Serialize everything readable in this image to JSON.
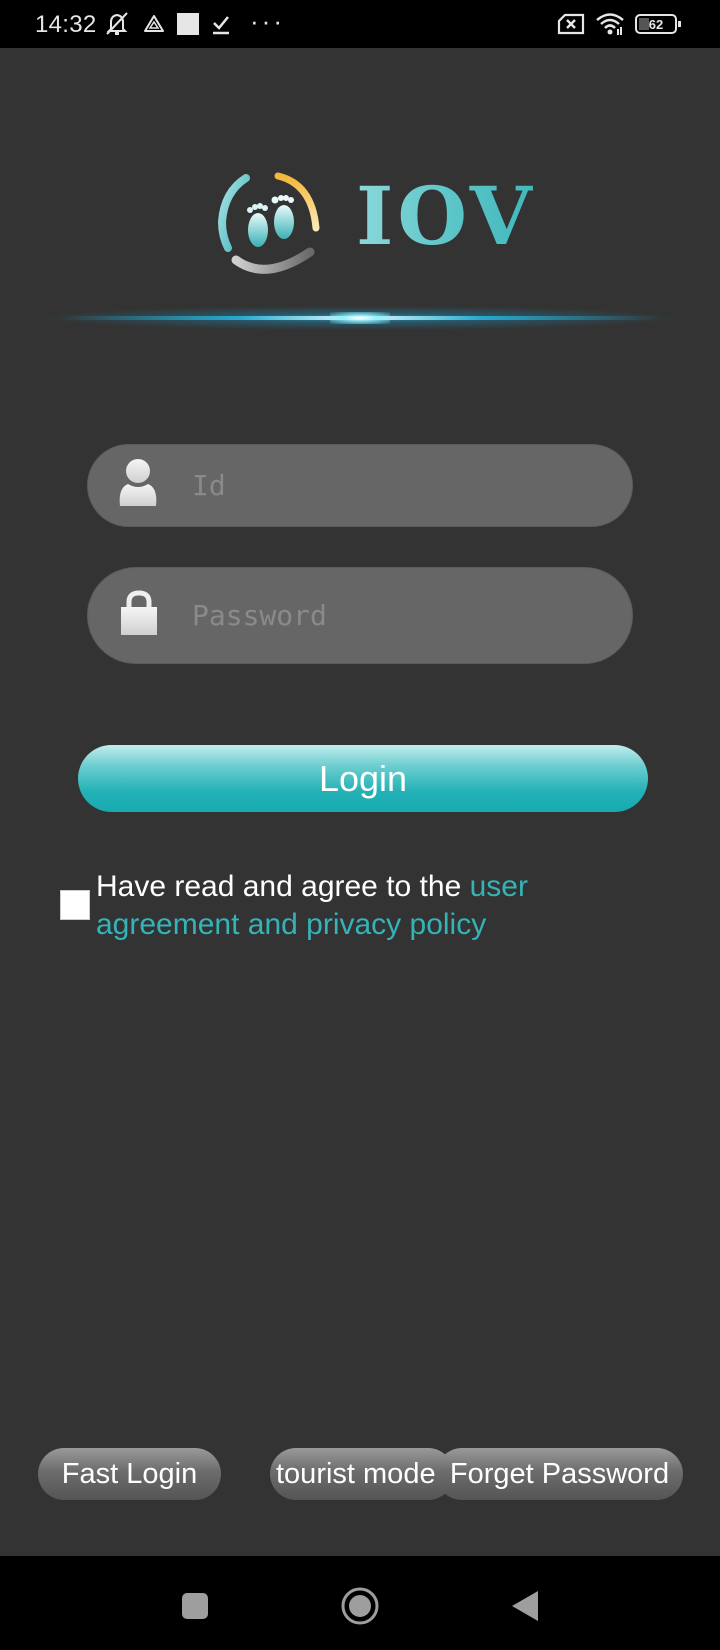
{
  "status_bar": {
    "time": "14:32",
    "left_icons": [
      "bell-off-icon",
      "drive-icon",
      "square-app-icon",
      "check-download-icon"
    ],
    "overflow": "···",
    "battery_level": "62",
    "right_icons": [
      "sim-off-icon",
      "wifi-icon",
      "battery-icon"
    ]
  },
  "app": {
    "logo_text": "IOV",
    "id_field": {
      "placeholder": "Id",
      "value": ""
    },
    "password_field": {
      "placeholder": "Password",
      "value": ""
    },
    "login_label": "Login",
    "agreement": {
      "checked": false,
      "prefix": "Have read and agree to the ",
      "link": "user agreement and privacy policy"
    },
    "bottom_buttons": {
      "fast_login": "Fast Login",
      "tourist_mode": "tourist mode",
      "forget_password": "Forget Password"
    }
  },
  "colors": {
    "background": "#333333",
    "accent": "#1aadb2",
    "link": "#34b3b8",
    "field": "#666666"
  },
  "nav_bar": {
    "buttons": [
      "recents",
      "home",
      "back"
    ]
  }
}
